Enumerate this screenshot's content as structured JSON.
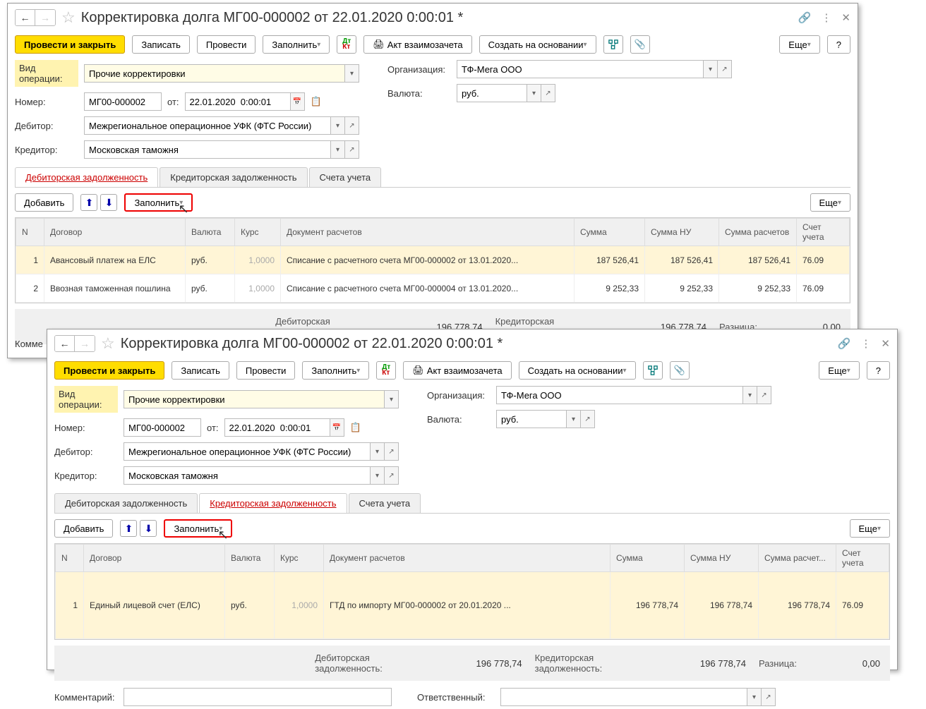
{
  "title": "Корректировка долга МГ00-000002 от 22.01.2020 0:00:01 *",
  "toolbar": {
    "post_close": "Провести и закрыть",
    "save": "Записать",
    "post": "Провести",
    "fill": "Заполнить",
    "act": "Акт взаимозачета",
    "create_based": "Создать на основании",
    "more": "Еще",
    "help": "?"
  },
  "form": {
    "op_type_label": "Вид операции:",
    "op_type": "Прочие корректировки",
    "org_label": "Организация:",
    "org": "ТФ-Мега ООО",
    "number_label": "Номер:",
    "number": "МГ00-000002",
    "date_label": "от:",
    "date": "22.01.2020  0:00:01",
    "currency_label": "Валюта:",
    "currency": "руб.",
    "debitor_label": "Дебитор:",
    "debitor": "Межрегиональное операционное УФК (ФТС России)",
    "creditor_label": "Кредитор:",
    "creditor": "Московская таможня"
  },
  "tabs": {
    "t1": "Дебиторская задолженность",
    "t2": "Кредиторская задолженность",
    "t3": "Счета учета"
  },
  "subbar": {
    "add": "Добавить",
    "fill": "Заполнить",
    "more": "Еще"
  },
  "grid_headers": {
    "n": "N",
    "contract": "Договор",
    "currency": "Валюта",
    "rate": "Курс",
    "doc": "Документ расчетов",
    "sum": "Сумма",
    "sum_nu": "Сумма НУ",
    "sum_calc": "Сумма расчетов",
    "sum_calc_short": "Сумма расчет...",
    "account": "Счет учета"
  },
  "grid1": [
    {
      "n": "1",
      "contract": "Авансовый платеж на ЕЛС",
      "currency": "руб.",
      "rate": "1,0000",
      "doc": "Списание с расчетного счета МГ00-000002 от 13.01.2020...",
      "sum": "187 526,41",
      "sum_nu": "187 526,41",
      "sum_calc": "187 526,41",
      "account": "76.09"
    },
    {
      "n": "2",
      "contract": "Ввозная таможенная пошлина",
      "currency": "руб.",
      "rate": "1,0000",
      "doc": "Списание с расчетного счета МГ00-000004 от 13.01.2020...",
      "sum": "9 252,33",
      "sum_nu": "9 252,33",
      "sum_calc": "9 252,33",
      "account": "76.09"
    }
  ],
  "grid2": [
    {
      "n": "1",
      "contract": "Единый лицевой счет (ЕЛС)",
      "currency": "руб.",
      "rate": "1,0000",
      "doc": "ГТД по импорту МГ00-000002 от 20.01.2020 ...",
      "sum": "196 778,74",
      "sum_nu": "196 778,74",
      "sum_calc": "196 778,74",
      "account": "76.09"
    }
  ],
  "summary": {
    "deb_label": "Дебиторская задолженность:",
    "deb_val": "196 778,74",
    "cred_label": "Кредиторская задолженность:",
    "cred_val": "196 778,74",
    "diff_label": "Разница:",
    "diff_val": "0,00"
  },
  "comment_clip": "Комме",
  "footer": {
    "comment_label": "Комментарий:",
    "resp_label": "Ответственный:"
  }
}
